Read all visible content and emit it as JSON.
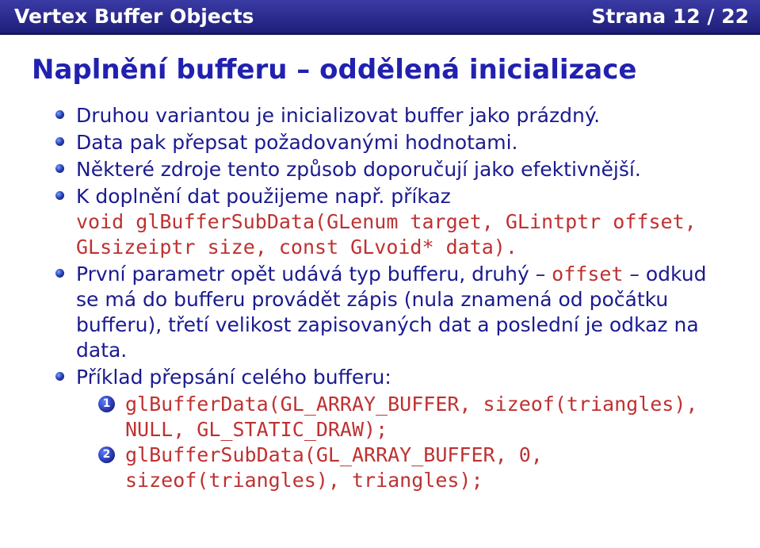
{
  "header": {
    "left": "Vertex Buffer Objects",
    "right": "Strana 12 / 22"
  },
  "title": "Naplnění bufferu – oddělená inicializace",
  "bullets": [
    {
      "text": "Druhou variantou je inicializovat buffer jako prázdný."
    },
    {
      "text": "Data pak přepsat požadovanými hodnotami."
    },
    {
      "text": "Některé zdroje tento způsob doporučují jako efektivnější."
    },
    {
      "text_pre": "K doplnění dat použijeme např. příkaz",
      "code": "void glBufferSubData(GLenum target, GLintptr offset, GLsizeiptr size, const GLvoid* data)",
      "text_post": "."
    },
    {
      "parts": [
        {
          "t": "text",
          "v": "První parametr opět udává typ bufferu, druhý – "
        },
        {
          "t": "code",
          "v": "offset"
        },
        {
          "t": "text",
          "v": " – odkud se má do bufferu provádět zápis (nula znamená od počátku bufferu), třetí velikost zapisovaných dat a poslední je odkaz na data."
        }
      ]
    },
    {
      "text": "Příklad přepsání celého bufferu:",
      "enum": [
        {
          "num": "1",
          "lines": [
            "glBufferData(GL_ARRAY_BUFFER, sizeof(triangles),",
            "NULL, GL_STATIC_DRAW);"
          ]
        },
        {
          "num": "2",
          "lines": [
            "glBufferSubData(GL_ARRAY_BUFFER, 0,",
            "sizeof(triangles), triangles);"
          ]
        }
      ]
    }
  ]
}
